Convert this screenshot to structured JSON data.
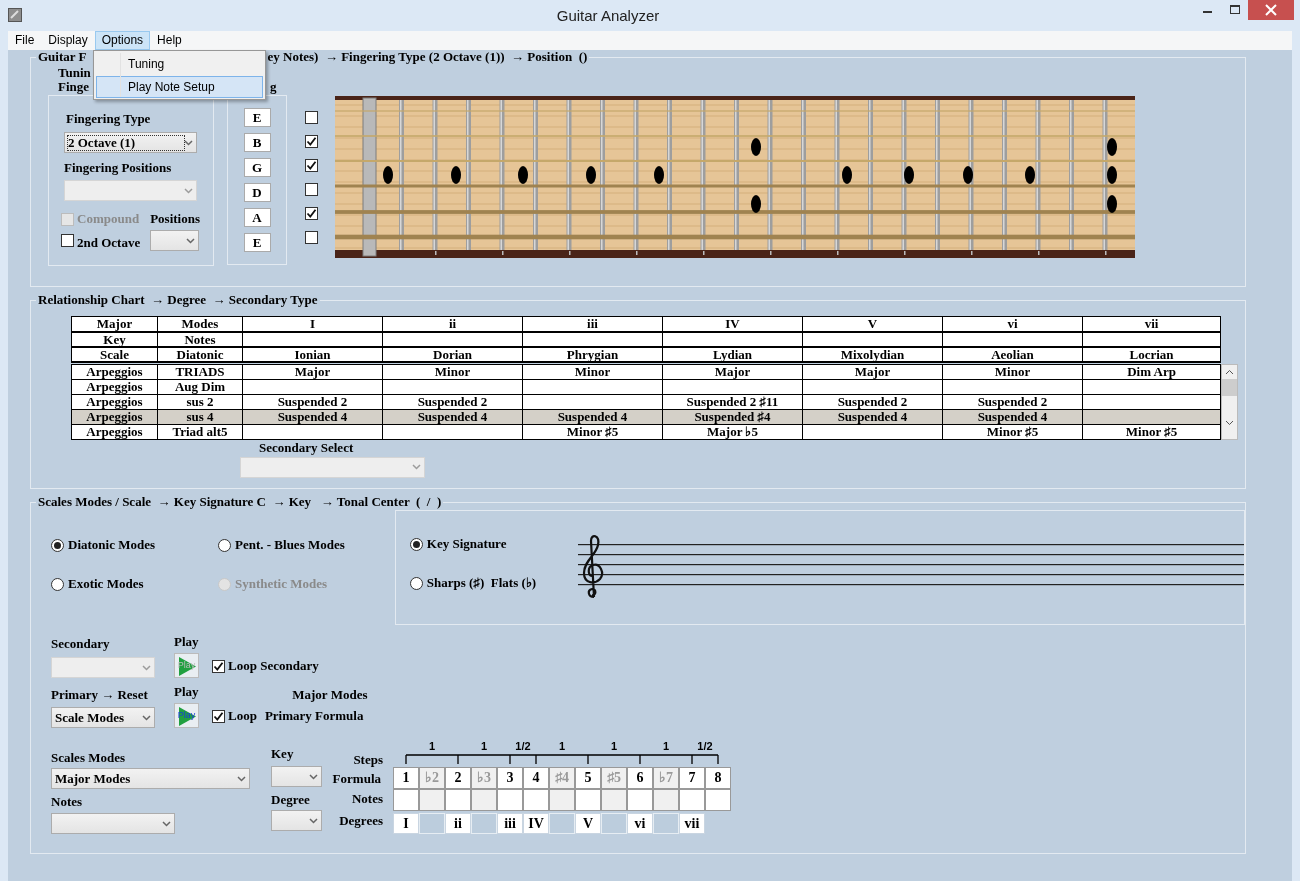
{
  "window": {
    "title": "Guitar Analyzer"
  },
  "menu": [
    {
      "label": "File",
      "selected": false
    },
    {
      "label": "Display",
      "selected": false
    },
    {
      "label": "Options",
      "selected": true
    },
    {
      "label": "Help",
      "selected": false
    }
  ],
  "options_menu": [
    {
      "label": "Tuning",
      "selected": false
    },
    {
      "label": "Play Note Setup",
      "selected": true
    }
  ],
  "fingering_panel": {
    "legend_start": "Guitar F",
    "legend_end": "ey Notes)  → Fingering Type (2 Octave (1))  → Position  ()",
    "line_1": "Tunin",
    "line_2": "Finge",
    "line_2_end": "g",
    "fingering_type_label": "Fingering Type",
    "fingering_type": {
      "value": "2 Octave (1)",
      "disabled": false
    },
    "fingering_positions_label": "Fingering Positions",
    "fingering_positions": {
      "disabled": true
    },
    "compound": {
      "label": "Compound",
      "checked": false,
      "disabled": true
    },
    "positions_label": "Positions",
    "positions": {
      "disabled": false
    },
    "second_octave": {
      "label": "2nd Octave",
      "checked": false,
      "disabled": false
    }
  },
  "strings": [
    {
      "note": "E",
      "checked": false
    },
    {
      "note": "B",
      "checked": true
    },
    {
      "note": "G",
      "checked": true
    },
    {
      "note": "D",
      "checked": false
    },
    {
      "note": "A",
      "checked": true
    },
    {
      "note": "E",
      "checked": false
    }
  ],
  "relationship": {
    "legend": "Relationship Chart  → Degree  → Secondary Type",
    "header_rows": [
      [
        "Major",
        "Modes",
        "I",
        "ii",
        "iii",
        "IV",
        "V",
        "vi",
        "vii"
      ],
      [
        "Key",
        "Notes",
        null,
        null,
        null,
        null,
        null,
        null,
        null
      ],
      [
        "Scale",
        "Diatonic",
        "Ionian",
        "Dorian",
        "Phrygian",
        "Lydian",
        "Mixolydian",
        "Aeolian",
        "Locrian"
      ]
    ],
    "rows": [
      {
        "cells": [
          "Arpeggios",
          "TRIADS",
          "Major",
          "Minor",
          "Minor",
          "Major",
          "Major",
          "Minor",
          "Dim Arp"
        ],
        "selected": false
      },
      {
        "cells": [
          "Arpeggios",
          "Aug Dim",
          null,
          null,
          null,
          null,
          null,
          null,
          null
        ],
        "selected": false
      },
      {
        "cells": [
          "Arpeggios",
          "sus 2",
          "Suspended 2",
          "Suspended 2",
          null,
          "Suspended 2 ♯11",
          "Suspended 2",
          "Suspended 2",
          null
        ],
        "selected": false
      },
      {
        "cells": [
          "Arpeggios",
          "sus 4",
          "Suspended 4",
          "Suspended 4",
          "Suspended 4",
          "Suspended ♯4",
          "Suspended 4",
          "Suspended 4",
          null
        ],
        "selected": true
      },
      {
        "cells": [
          "Arpeggios",
          "Triad alt5",
          null,
          null,
          "Minor ♯5",
          "Major ♭5",
          null,
          "Minor ♯5",
          "Minor ♯5"
        ],
        "selected": false
      }
    ],
    "secondary_select_label": "Secondary Select",
    "secondary_select": {
      "disabled": true
    }
  },
  "scales": {
    "legend": "Scales Modes / Scale  → Key Signature C  → Key   → Tonal Center  (  /  )",
    "mode_options": [
      {
        "label": "Diatonic Modes",
        "selected": true,
        "disabled": false
      },
      {
        "label": "Pent. - Blues Modes",
        "selected": false,
        "disabled": false
      },
      {
        "label": "Exotic Modes",
        "selected": false,
        "disabled": false
      },
      {
        "label": "Synthetic Modes",
        "selected": false,
        "disabled": true
      }
    ],
    "key_options": [
      {
        "label": "Key Signature",
        "selected": true
      },
      {
        "label": "Sharps (♯)  Flats (♭)",
        "selected": false
      }
    ],
    "secondary_label": "Secondary",
    "secondary_select": {
      "disabled": true
    },
    "secondary_play_label": "Play",
    "secondary_play_button": {
      "label": "Play",
      "disabled": true
    },
    "loop_secondary": {
      "label": "Loop Secondary",
      "checked": true
    },
    "primary_label": "Primary → Reset",
    "primary_select": {
      "value": "Scale Modes",
      "disabled": false
    },
    "primary_play_label": "Play",
    "primary_play_button": {
      "label": "Play",
      "disabled": false
    },
    "loop_primary": {
      "label": "Loop",
      "checked": true
    },
    "formula_title": "Major Modes",
    "formula_caption": "Primary Formula",
    "scales_modes_label": "Scales Modes",
    "scales_modes_select": {
      "value": "Major Modes",
      "disabled": false
    },
    "notes_label": "Notes",
    "notes_select": {
      "disabled": false
    },
    "key_label": "Key",
    "key_select": {
      "disabled": false
    },
    "degree_label": "Degree",
    "degree_select": {
      "disabled": false
    },
    "row_labels": [
      "Steps",
      "Formula",
      "Notes",
      "Degrees"
    ],
    "steps": [
      {
        "label": "1",
        "kind": "whole"
      },
      {
        "label": "1",
        "kind": "whole"
      },
      {
        "label": "1/2",
        "kind": "half"
      },
      {
        "label": "1",
        "kind": "whole"
      },
      {
        "label": "1",
        "kind": "whole"
      },
      {
        "label": "1",
        "kind": "whole"
      },
      {
        "label": "1/2",
        "kind": "half"
      }
    ],
    "formula": [
      {
        "label": "1",
        "enabled": true
      },
      {
        "label": "♭2",
        "enabled": false
      },
      {
        "label": "2",
        "enabled": true
      },
      {
        "label": "♭3",
        "enabled": false
      },
      {
        "label": "3",
        "enabled": true
      },
      {
        "label": "4",
        "enabled": true
      },
      {
        "label": "♯4",
        "enabled": false
      },
      {
        "label": "5",
        "enabled": true
      },
      {
        "label": "♯5",
        "enabled": false
      },
      {
        "label": "6",
        "enabled": true
      },
      {
        "label": "♭7",
        "enabled": false
      },
      {
        "label": "7",
        "enabled": true
      },
      {
        "label": "8",
        "enabled": true
      }
    ],
    "degrees": [
      {
        "kind": "degree",
        "label": "I"
      },
      {
        "kind": "blank"
      },
      {
        "kind": "degree",
        "label": "ii"
      },
      {
        "kind": "blank"
      },
      {
        "kind": "degree",
        "label": "iii"
      },
      {
        "kind": "degree",
        "label": "IV"
      },
      {
        "kind": "blank"
      },
      {
        "kind": "degree",
        "label": "V"
      },
      {
        "kind": "blank"
      },
      {
        "kind": "degree",
        "label": "vi"
      },
      {
        "kind": "blank"
      },
      {
        "kind": "degree",
        "label": "vii"
      }
    ]
  }
}
